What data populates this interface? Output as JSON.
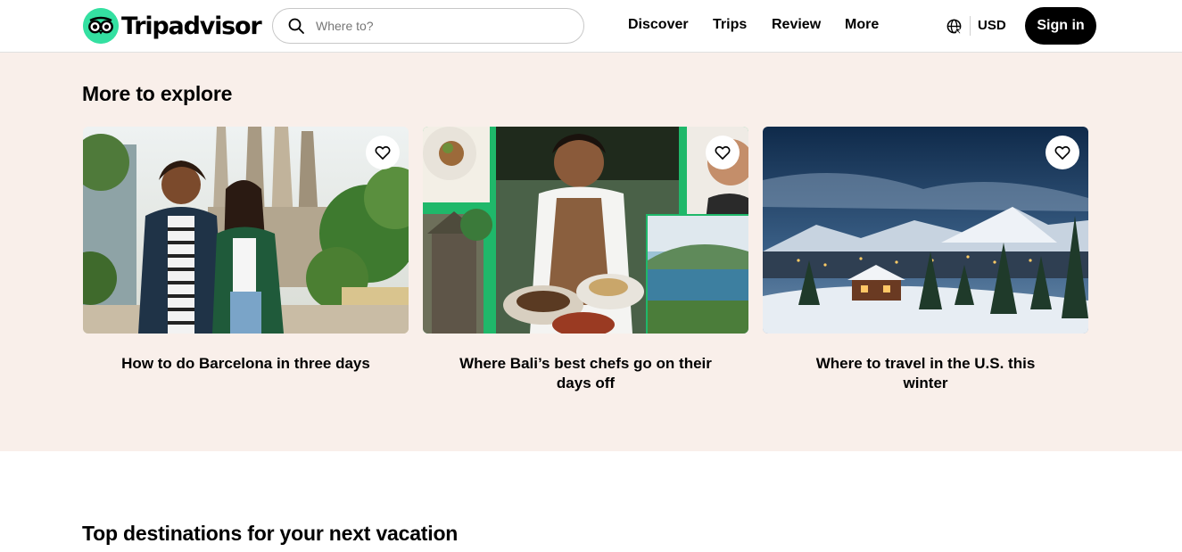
{
  "header": {
    "logo_text": "Tripadvisor",
    "search_placeholder": "Where to?",
    "nav": [
      "Discover",
      "Trips",
      "Review",
      "More"
    ],
    "currency": "USD",
    "sign_in": "Sign in"
  },
  "explore": {
    "title": "More to explore",
    "cards": [
      {
        "title": "How to do Barcelona in three days",
        "icon": "heart-icon"
      },
      {
        "title": "Where Bali’s best chefs go on their days off",
        "icon": "heart-icon"
      },
      {
        "title": "Where to travel in the U.S. this winter",
        "icon": "heart-icon"
      }
    ]
  },
  "destinations": {
    "title": "Top destinations for your next vacation"
  },
  "colors": {
    "brand_green": "#34e0a1",
    "section_bg": "#f9efea",
    "button_black": "#000000"
  }
}
